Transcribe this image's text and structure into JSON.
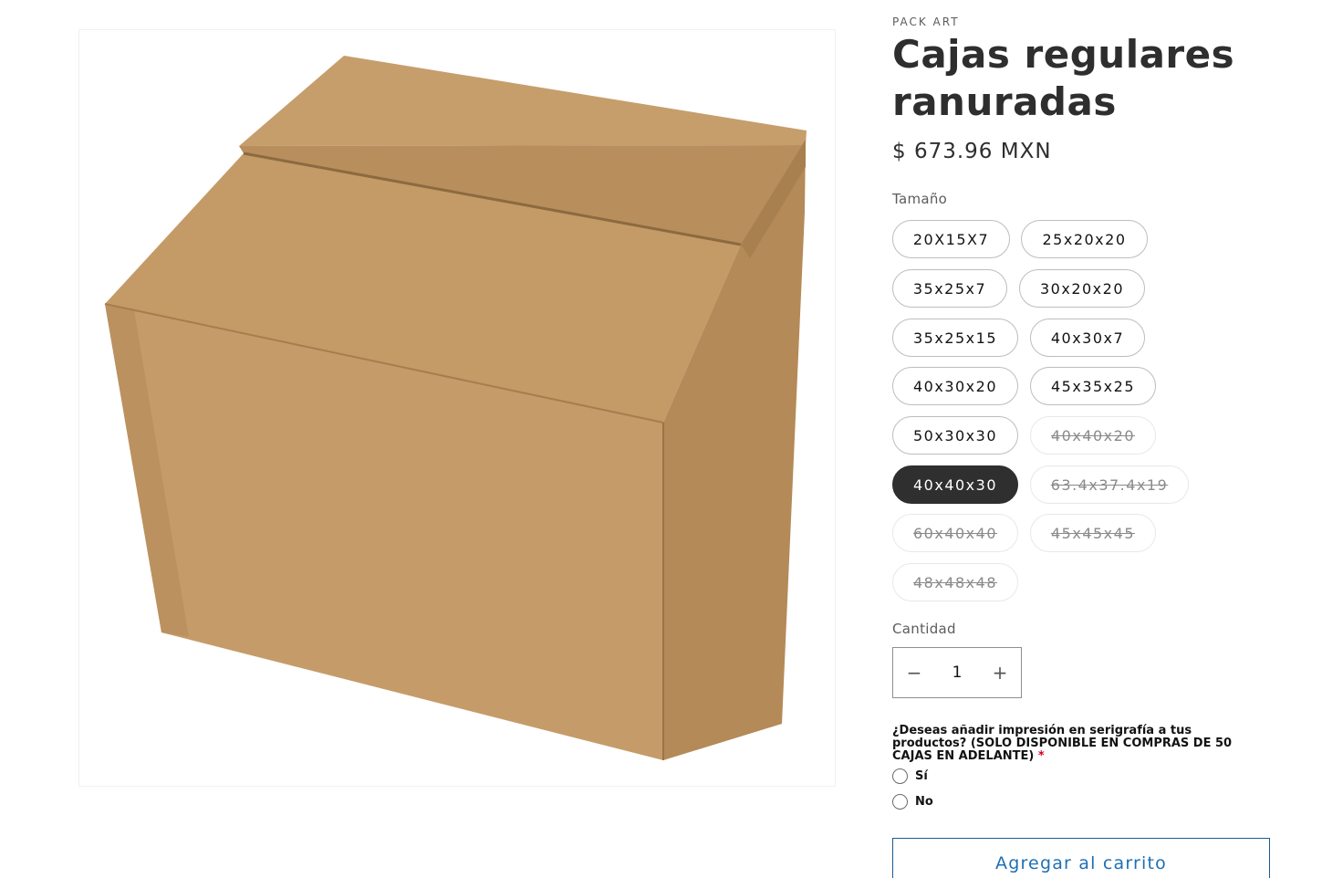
{
  "product": {
    "vendor": "PACK ART",
    "title": "Cajas regulares ranuradas",
    "price": "$ 673.96 MXN",
    "image_alt": "cardboard-box"
  },
  "size_option": {
    "label": "Tamaño",
    "options": [
      {
        "value": "20X15X7",
        "state": "available"
      },
      {
        "value": "25x20x20",
        "state": "available"
      },
      {
        "value": "35x25x7",
        "state": "available"
      },
      {
        "value": "30x20x20",
        "state": "available"
      },
      {
        "value": "35x25x15",
        "state": "available"
      },
      {
        "value": "40x30x7",
        "state": "available"
      },
      {
        "value": "40x30x20",
        "state": "available"
      },
      {
        "value": "45x35x25",
        "state": "available"
      },
      {
        "value": "50x30x30",
        "state": "available"
      },
      {
        "value": "40x40x20",
        "state": "unavailable"
      },
      {
        "value": "40x40x30",
        "state": "selected"
      },
      {
        "value": "63.4x37.4x19",
        "state": "unavailable"
      },
      {
        "value": "60x40x40",
        "state": "unavailable"
      },
      {
        "value": "45x45x45",
        "state": "unavailable"
      },
      {
        "value": "48x48x48",
        "state": "unavailable"
      }
    ]
  },
  "quantity": {
    "label": "Cantidad",
    "value": "1",
    "minus": "−",
    "plus": "+"
  },
  "serigraphy": {
    "question": "¿Deseas añadir impresión en serigrafía a tus productos? (SOLO DISPONIBLE EN COMPRAS DE 50 CAJAS EN ADELANTE)",
    "required_mark": "*",
    "options": [
      "Sí",
      "No"
    ]
  },
  "cart": {
    "add_label": "Agregar al carrito"
  },
  "colors": {
    "selected_pill": "#2f2f2f",
    "button_text": "#1f6fb3",
    "required": "#d6001c"
  }
}
